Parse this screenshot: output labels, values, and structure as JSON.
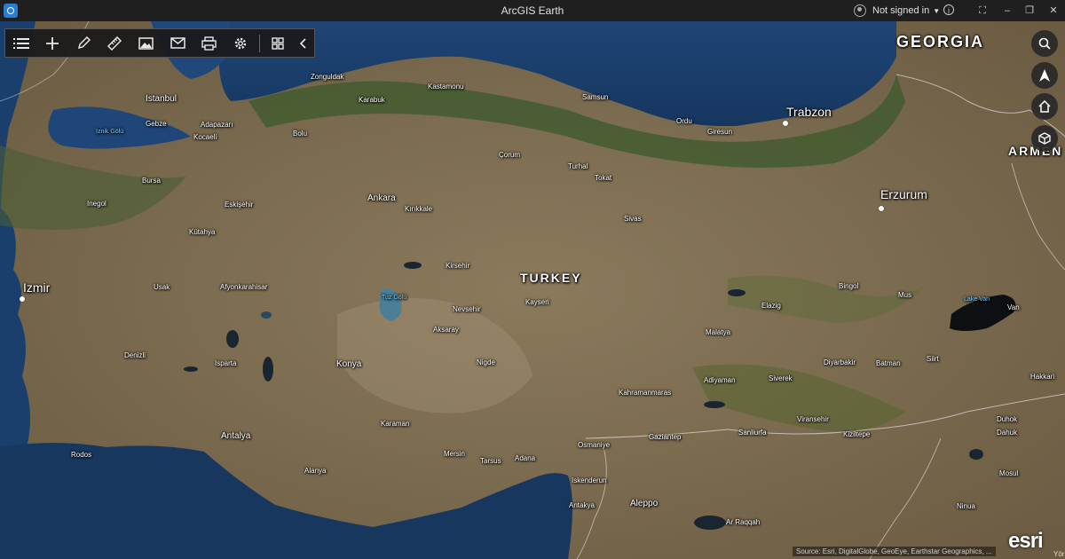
{
  "window": {
    "title": "ArcGIS Earth",
    "user": "Not signed in"
  },
  "toolbar": {
    "tools": [
      {
        "name": "table-of-contents",
        "icon": "list-icon"
      },
      {
        "name": "add-data",
        "icon": "plus-icon"
      },
      {
        "name": "draw",
        "icon": "pencil-icon"
      },
      {
        "name": "measure",
        "icon": "ruler-icon"
      },
      {
        "name": "snapshot",
        "icon": "image-icon"
      },
      {
        "name": "share",
        "icon": "mail-icon"
      },
      {
        "name": "print",
        "icon": "printer-icon"
      },
      {
        "name": "settings",
        "icon": "gear-icon"
      },
      {
        "name": "more-tools",
        "icon": "grid-icon"
      },
      {
        "name": "collapse",
        "icon": "chevron-left-icon"
      }
    ]
  },
  "nav": [
    "search-icon",
    "compass-icon",
    "home-icon",
    "3d-view-icon"
  ],
  "map": {
    "countries": {
      "turkey": "TURKEY",
      "georgia": "GEORGIA",
      "armenia": "ARMEN"
    },
    "cities": {
      "trabzon": "Trabzon",
      "erzurum": "Erzurum",
      "izmir": "Izmir",
      "zonguldak": "Zonguldak",
      "istanbul": "Istanbul",
      "karabuk": "Karabuk",
      "kastamonu": "Kastamonu",
      "samsun": "Samsun",
      "ordu": "Ordu",
      "giresun": "Giresun",
      "gebze": "Gebze",
      "adapazari": "Adapazarı",
      "kocaeli": "Kocaeli",
      "bolu": "Bolu",
      "corum": "Çorum",
      "turhal": "Turhal",
      "tokat": "Tokat",
      "bursa": "Bursa",
      "inegol": "Inegol",
      "eskisehir": "Eskişehir",
      "ankara": "Ankara",
      "kirikkale": "Kırıkkale",
      "sivas": "Sivas",
      "kutahya": "Kütahya",
      "kirsehir": "Kirsehir",
      "usak": "Usak",
      "afyonkarahisar": "Afyonkarahisar",
      "nevsehir": "Nevsehir",
      "kayseri": "Kayseri",
      "bingol": "Bingol",
      "mus": "Mus",
      "elazig": "Elazig",
      "van": "Van",
      "aksaray": "Aksaray",
      "malatya": "Malatya",
      "denizli": "Denizli",
      "isparta": "Isparta",
      "konya": "Konya",
      "nigde": "Nigde",
      "diyarbakir": "Diyarbakir",
      "batman": "Batman",
      "siirt": "Siirt",
      "adiyaman": "Adiyaman",
      "siverek": "Siverek",
      "hakkari": "Hakkari",
      "kahramanmaras": "Kahramanmaras",
      "karaman": "Karaman",
      "viransehir": "Viransehir",
      "duhok": "Duhok",
      "antalya": "Antalya",
      "sanliurfa": "Sanliurfa",
      "kiziltepe": "Kiziltepe",
      "dahuk": "Dahuk",
      "osmaniye": "Osmaniye",
      "gaziantep": "Gaziantep",
      "rodos": "Rodos",
      "alanya": "Alanya",
      "mersin": "Mersin",
      "tarsus": "Tarsus",
      "adana": "Adana",
      "iskenderun": "Iskenderun",
      "mosul": "Mosul",
      "antakya": "Antakya",
      "aleppo": "Aleppo",
      "ninua": "Ninua",
      "ar_raqqah": "Ar Raqqah"
    },
    "water": {
      "lake_van": "Lake Van",
      "lake_tuz": "Tuz Gölü",
      "marmara": "Iznik Gölü"
    }
  },
  "attribution": "Source: Esri, DigitalGlobe, GeoEye, Earthstar Geographics, ...",
  "logo": "esri",
  "partial_label": "Yörk",
  "colors": {
    "sea": "#1d3f6e",
    "land": "#7c6b50",
    "vegetation": "#3f5a2e",
    "titlebar": "#1f1f1f"
  }
}
